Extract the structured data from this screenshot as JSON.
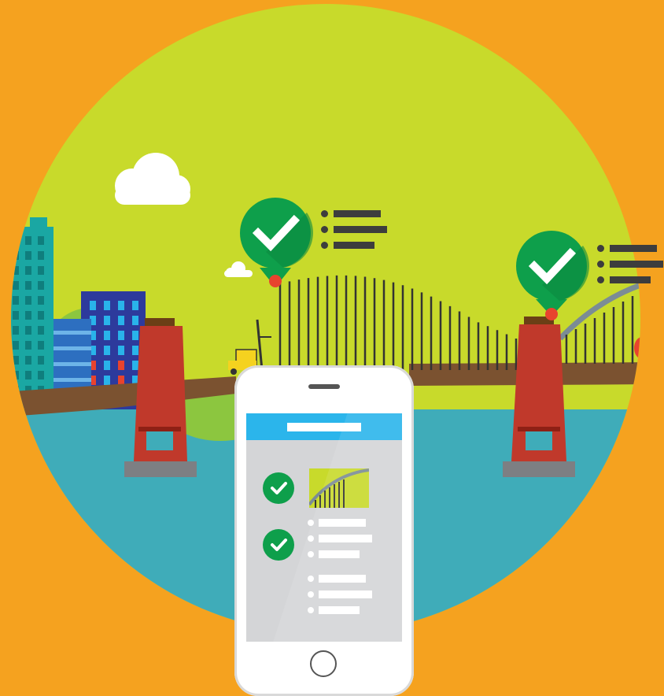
{
  "scene": {
    "description_colors": {
      "background": "#F5A21F",
      "sky_circle": "#C8DA2B",
      "water": "#3FACB9",
      "bridge_deck": "#7B5230",
      "tower": "#C0392B",
      "check_green": "#0E9F4B",
      "pin_red": "#E8432E",
      "phone_header": "#2BB5EB"
    },
    "icons": [
      "cloud-icon",
      "check-pin-icon",
      "check-icon",
      "home-button-icon",
      "forklift-icon"
    ]
  },
  "phone": {
    "checks": 2,
    "list_groups": [
      3,
      3
    ]
  }
}
